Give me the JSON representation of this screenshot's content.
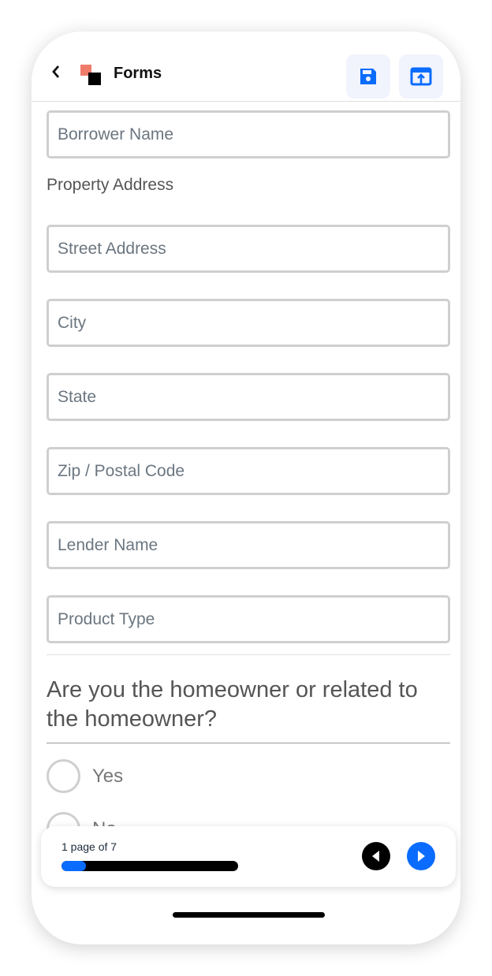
{
  "header": {
    "title": "Forms",
    "back_icon": "chevron-left-icon",
    "save_icon": "floppy-disk-icon",
    "export_icon": "upload-box-icon",
    "accent": "#0a6cff"
  },
  "form": {
    "borrower_name_placeholder": "Borrower Name",
    "property_address_label": "Property Address",
    "street_placeholder": "Street Address",
    "city_placeholder": "City",
    "state_placeholder": "State",
    "zip_placeholder": "Zip / Postal Code",
    "lender_placeholder": "Lender Name",
    "product_placeholder": "Product Type",
    "question": "Are you the homeowner or related to the homeowner?",
    "options": [
      {
        "label": "Yes",
        "selected": false
      },
      {
        "label": "No",
        "selected": false
      }
    ]
  },
  "pager": {
    "text": "1 page of 7",
    "current": 1,
    "total": 7,
    "progress_fraction": 0.14
  }
}
